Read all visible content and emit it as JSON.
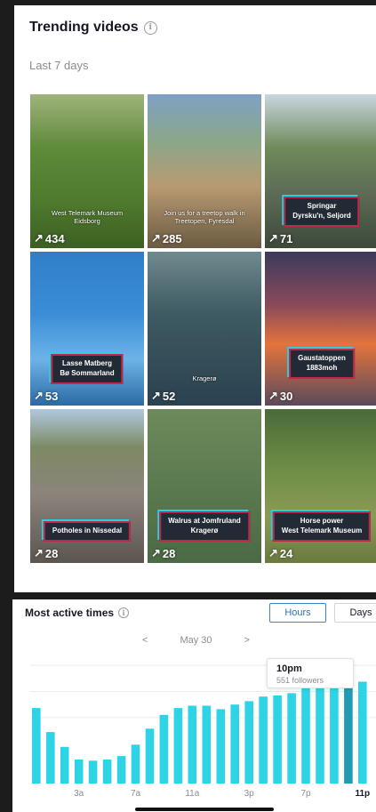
{
  "trending": {
    "title": "Trending videos",
    "subtitle": "Last 7 days",
    "videos": [
      {
        "count": "434",
        "caption": "West Telemark Museum\nEidsborg",
        "style": "plain"
      },
      {
        "count": "285",
        "caption": "Join us for a treetop walk in\nTreetopen, Fyresdal",
        "style": "plain"
      },
      {
        "count": "71",
        "caption": "Springar\nDyrsku'n, Seljord",
        "style": "box"
      },
      {
        "count": "53",
        "caption": "Lasse Matberg\nBø Sommarland",
        "style": "box"
      },
      {
        "count": "52",
        "caption": "Kragerø",
        "style": "plain"
      },
      {
        "count": "30",
        "caption": "Gaustatoppen\n1883moh",
        "style": "box"
      },
      {
        "count": "28",
        "caption": "Potholes in Nissedal",
        "style": "box"
      },
      {
        "count": "28",
        "caption": "Walrus at Jomfruland\nKragerø",
        "style": "box"
      },
      {
        "count": "24",
        "caption": "Horse power\nWest Telemark Museum",
        "style": "box"
      }
    ]
  },
  "active_times": {
    "title": "Most active times",
    "tabs": {
      "hours": "Hours",
      "days": "Days"
    },
    "date": "May 30",
    "prev": "<",
    "next": ">",
    "tooltip": {
      "time": "10pm",
      "value": "551 followers"
    },
    "accent": "#2fd3e8",
    "highlight": "#1f9bb5"
  },
  "chart_data": {
    "type": "bar",
    "x": [
      "12a",
      "1a",
      "2a",
      "3a",
      "4a",
      "5a",
      "6a",
      "7a",
      "8a",
      "9a",
      "10a",
      "11a",
      "12p",
      "1p",
      "2p",
      "3p",
      "4p",
      "5p",
      "6p",
      "7p",
      "8p",
      "9p",
      "10p",
      "11p"
    ],
    "tick_labels": [
      "3a",
      "7a",
      "11a",
      "3p",
      "7p",
      "11p"
    ],
    "values": [
      330,
      225,
      160,
      105,
      100,
      105,
      120,
      170,
      240,
      300,
      330,
      340,
      340,
      325,
      345,
      360,
      380,
      385,
      395,
      430,
      440,
      450,
      475,
      445
    ],
    "highlight_index": 22,
    "ylim": [
      0,
      600
    ]
  }
}
